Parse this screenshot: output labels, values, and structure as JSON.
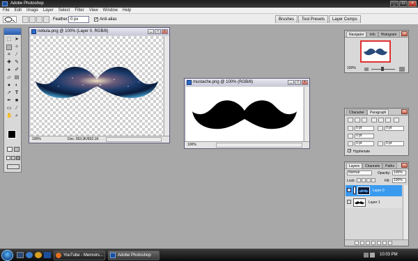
{
  "app": {
    "title": "Adobe Photoshop"
  },
  "window_controls": {
    "minimize": "_",
    "maximize": "□",
    "close": "×"
  },
  "menu": [
    "File",
    "Edit",
    "Image",
    "Layer",
    "Select",
    "Filter",
    "View",
    "Window",
    "Help"
  ],
  "options_bar": {
    "feather_label": "Feather:",
    "feather_value": "0 px",
    "antialias_label": "Anti-alias",
    "antialias_checked": true,
    "palette_tabs": [
      "Brushes",
      "Tool Presets",
      "Layer Comps"
    ]
  },
  "documents": [
    {
      "title": "nebula.png @ 100% (Layer 0, RGB/8)",
      "zoom": "100%",
      "doc_info": "Doc: 363.3K/832.1K"
    },
    {
      "title": "mustache.png @ 100% (RGB/8)",
      "zoom": "100%"
    }
  ],
  "navigator_panel": {
    "tabs": [
      "Navigator",
      "Info",
      "Histogram"
    ],
    "zoom": "100%"
  },
  "character_panel": {
    "tabs": [
      "Character",
      "Paragraph"
    ],
    "fields": [
      "0 pt",
      "0 pt",
      "0 pt",
      "0 pt",
      "0 pt"
    ],
    "hyphenate_label": "Hyphenate",
    "hyphenate_checked": true
  },
  "layers_panel": {
    "tabs": [
      "Layers",
      "Channels",
      "Paths"
    ],
    "blend_mode": "Normal",
    "opacity_label": "Opacity:",
    "opacity": "100%",
    "lock_label": "Lock:",
    "fill_label": "Fill:",
    "fill": "100%",
    "layers": [
      {
        "name": "Layer 0",
        "selected": true
      },
      {
        "name": "Layer 1",
        "selected": false
      }
    ]
  },
  "taskbar": {
    "tasks": [
      "YouTube - Memoirs...",
      "Adobe Photoshop"
    ],
    "clock": "10:03 PM"
  },
  "colors": {
    "selection_blue": "#3a9aef",
    "title_bar": "#1d1d1d",
    "workspace": "#a8a8a8"
  }
}
